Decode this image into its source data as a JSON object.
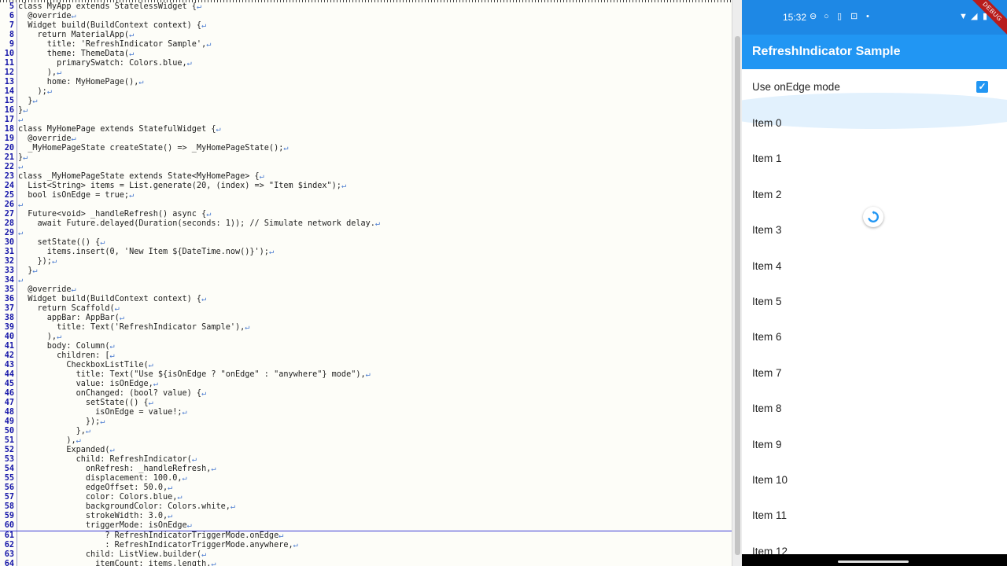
{
  "editor": {
    "lines": [
      {
        "no": "5",
        "text": "class MyApp extends StatelessWidget {"
      },
      {
        "no": "6",
        "text": "  @override"
      },
      {
        "no": "7",
        "text": "  Widget build(BuildContext context) {"
      },
      {
        "no": "8",
        "text": "    return MaterialApp("
      },
      {
        "no": "9",
        "text": "      title: 'RefreshIndicator Sample',"
      },
      {
        "no": "10",
        "text": "      theme: ThemeData("
      },
      {
        "no": "11",
        "text": "        primarySwatch: Colors.blue,"
      },
      {
        "no": "12",
        "text": "      ),"
      },
      {
        "no": "13",
        "text": "      home: MyHomePage(),"
      },
      {
        "no": "14",
        "text": "    );"
      },
      {
        "no": "15",
        "text": "  }"
      },
      {
        "no": "16",
        "text": "}"
      },
      {
        "no": "17",
        "text": ""
      },
      {
        "no": "18",
        "text": "class MyHomePage extends StatefulWidget {"
      },
      {
        "no": "19",
        "text": "  @override"
      },
      {
        "no": "20",
        "text": "  _MyHomePageState createState() => _MyHomePageState();"
      },
      {
        "no": "21",
        "text": "}"
      },
      {
        "no": "22",
        "text": ""
      },
      {
        "no": "23",
        "text": "class _MyHomePageState extends State<MyHomePage> {"
      },
      {
        "no": "24",
        "text": "  List<String> items = List.generate(20, (index) => \"Item $index\");"
      },
      {
        "no": "25",
        "text": "  bool isOnEdge = true;"
      },
      {
        "no": "26",
        "text": ""
      },
      {
        "no": "27",
        "text": "  Future<void> _handleRefresh() async {"
      },
      {
        "no": "28",
        "text": "    await Future.delayed(Duration(seconds: 1)); // Simulate network delay."
      },
      {
        "no": "29",
        "text": ""
      },
      {
        "no": "30",
        "text": "    setState(() {"
      },
      {
        "no": "31",
        "text": "      items.insert(0, 'New Item ${DateTime.now()}');"
      },
      {
        "no": "32",
        "text": "    });"
      },
      {
        "no": "33",
        "text": "  }"
      },
      {
        "no": "34",
        "text": ""
      },
      {
        "no": "35",
        "text": "  @override"
      },
      {
        "no": "36",
        "text": "  Widget build(BuildContext context) {"
      },
      {
        "no": "37",
        "text": "    return Scaffold("
      },
      {
        "no": "38",
        "text": "      appBar: AppBar("
      },
      {
        "no": "39",
        "text": "        title: Text('RefreshIndicator Sample'),"
      },
      {
        "no": "40",
        "text": "      ),"
      },
      {
        "no": "41",
        "text": "      body: Column("
      },
      {
        "no": "42",
        "text": "        children: ["
      },
      {
        "no": "43",
        "text": "          CheckboxListTile("
      },
      {
        "no": "44",
        "text": "            title: Text(\"Use ${isOnEdge ? \"onEdge\" : \"anywhere\"} mode\"),"
      },
      {
        "no": "45",
        "text": "            value: isOnEdge,"
      },
      {
        "no": "46",
        "text": "            onChanged: (bool? value) {"
      },
      {
        "no": "47",
        "text": "              setState(() {"
      },
      {
        "no": "48",
        "text": "                isOnEdge = value!;"
      },
      {
        "no": "49",
        "text": "              });"
      },
      {
        "no": "50",
        "text": "            },"
      },
      {
        "no": "51",
        "text": "          ),"
      },
      {
        "no": "52",
        "text": "          Expanded("
      },
      {
        "no": "53",
        "text": "            child: RefreshIndicator("
      },
      {
        "no": "54",
        "text": "              onRefresh: _handleRefresh,"
      },
      {
        "no": "55",
        "text": "              displacement: 100.0,"
      },
      {
        "no": "56",
        "text": "              edgeOffset: 50.0,"
      },
      {
        "no": "57",
        "text": "              color: Colors.blue,"
      },
      {
        "no": "58",
        "text": "              backgroundColor: Colors.white,"
      },
      {
        "no": "59",
        "text": "              strokeWidth: 3.0,"
      },
      {
        "no": "60",
        "text": "              triggerMode: isOnEdge",
        "current": true
      },
      {
        "no": "61",
        "text": "                  ? RefreshIndicatorTriggerMode.onEdge"
      },
      {
        "no": "62",
        "text": "                  : RefreshIndicatorTriggerMode.anywhere,"
      },
      {
        "no": "63",
        "text": "              child: ListView.builder("
      },
      {
        "no": "64",
        "text": "                itemCount: items.length,"
      }
    ]
  },
  "device": {
    "status_bar": {
      "time": "15:32",
      "icons": [
        "no-disturb-icon",
        "dot-icon",
        "sim-icon",
        "screen-icon",
        "small-dot-icon"
      ],
      "right_icons": [
        "wifi-icon",
        "signal-icon",
        "battery-icon"
      ]
    },
    "debug_banner": "DEBUG",
    "app_bar": {
      "title": "RefreshIndicator Sample"
    },
    "checkbox_tile": {
      "label": "Use onEdge mode",
      "checked": true
    },
    "items": [
      "Item 0",
      "Item 1",
      "Item 2",
      "Item 3",
      "Item 4",
      "Item 5",
      "Item 6",
      "Item 7",
      "Item 8",
      "Item 9",
      "Item 10",
      "Item 11",
      "Item 12"
    ],
    "colors": {
      "status_bar": "#1e88e5",
      "app_bar": "#2196f3",
      "accent": "#2196f3",
      "banner": "#b71c1c"
    }
  }
}
